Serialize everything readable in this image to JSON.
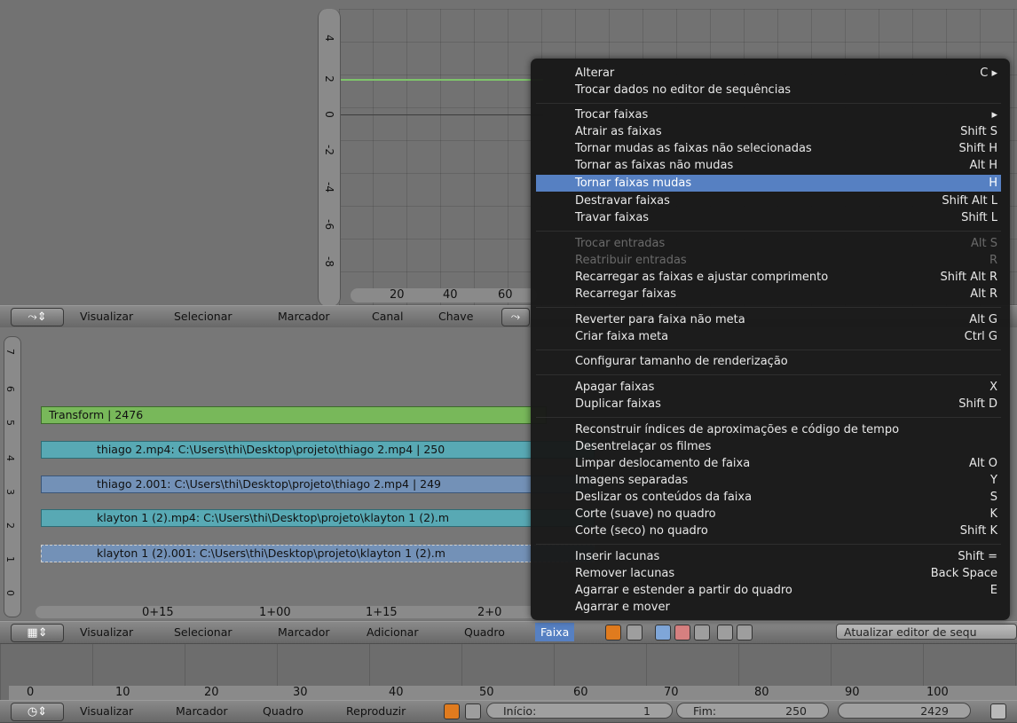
{
  "graph": {
    "vticks": [
      "4",
      "2",
      "0",
      "-2",
      "-4",
      "-6",
      "-8"
    ],
    "hticks": [
      "20",
      "40",
      "60"
    ]
  },
  "graph_header": {
    "items": [
      "Visualizar",
      "Selecionar",
      "Marcador",
      "Canal",
      "Chave"
    ]
  },
  "sequencer": {
    "channels": [
      "7",
      "6",
      "5",
      "4",
      "3",
      "2",
      "1",
      "0"
    ],
    "strips": [
      {
        "label": "Transform | 2476",
        "color": "#78b85a"
      },
      {
        "label": "thiago 2.mp4: C:\\Users\\thi\\Desktop\\projeto\\thiago 2.mp4 | 250",
        "color": "#58a9b4"
      },
      {
        "label": "thiago 2.001: C:\\Users\\thi\\Desktop\\projeto\\thiago 2.mp4 | 249",
        "color": "#7391b7"
      },
      {
        "label": "klayton 1 (2).mp4: C:\\Users\\thi\\Desktop\\projeto\\klayton 1 (2).m",
        "color": "#58a9b4"
      },
      {
        "label": "klayton 1 (2).001: C:\\Users\\thi\\Desktop\\projeto\\klayton 1 (2).m",
        "color": "#7391b7"
      }
    ],
    "timeline_ticks": [
      "0+15",
      "1+00",
      "1+15",
      "2+0"
    ]
  },
  "seq_header": {
    "items": [
      "Visualizar",
      "Selecionar",
      "Marcador",
      "Adicionar",
      "Quadro",
      "Faixa"
    ],
    "refresh_label": "Atualizar editor de sequ"
  },
  "timeline": {
    "ticks": [
      "0",
      "10",
      "20",
      "30",
      "40",
      "50",
      "60",
      "70",
      "80",
      "90",
      "100"
    ]
  },
  "timeline_header": {
    "items": [
      "Visualizar",
      "Marcador",
      "Quadro",
      "Reproduzir"
    ],
    "start_label": "Início:",
    "start_value": "1",
    "end_label": "Fim:",
    "end_value": "250",
    "current_value": "2429"
  },
  "menu": {
    "items": [
      {
        "label": "Alterar",
        "shortcut": "C ▸"
      },
      {
        "label": "Trocar dados no editor de sequências",
        "shortcut": ""
      },
      {
        "label": "Trocar faixas",
        "shortcut": "▸"
      },
      {
        "label": "Atrair as faixas",
        "shortcut": "Shift S"
      },
      {
        "label": "Tornar mudas as faixas não selecionadas",
        "shortcut": "Shift H"
      },
      {
        "label": "Tornar as faixas não mudas",
        "shortcut": "Alt H"
      },
      {
        "label": "Tornar faixas mudas",
        "shortcut": "H"
      },
      {
        "label": "Destravar faixas",
        "shortcut": "Shift Alt L"
      },
      {
        "label": "Travar faixas",
        "shortcut": "Shift L"
      },
      {
        "label": "Trocar entradas",
        "shortcut": "Alt S"
      },
      {
        "label": "Reatribuir entradas",
        "shortcut": "R"
      },
      {
        "label": "Recarregar as faixas e ajustar comprimento",
        "shortcut": "Shift Alt R"
      },
      {
        "label": "Recarregar faixas",
        "shortcut": "Alt R"
      },
      {
        "label": "Reverter para faixa não meta",
        "shortcut": "Alt G"
      },
      {
        "label": "Criar faixa meta",
        "shortcut": "Ctrl G"
      },
      {
        "label": "Configurar tamanho de renderização",
        "shortcut": ""
      },
      {
        "label": "Apagar faixas",
        "shortcut": "X"
      },
      {
        "label": "Duplicar faixas",
        "shortcut": "Shift D"
      },
      {
        "label": "Reconstruir índices de aproximações e código de tempo",
        "shortcut": ""
      },
      {
        "label": "Desentrelaçar os filmes",
        "shortcut": ""
      },
      {
        "label": "Limpar deslocamento de faixa",
        "shortcut": "Alt O"
      },
      {
        "label": "Imagens separadas",
        "shortcut": "Y"
      },
      {
        "label": "Deslizar os conteúdos da faixa",
        "shortcut": "S"
      },
      {
        "label": "Corte (suave) no quadro",
        "shortcut": "K"
      },
      {
        "label": "Corte (seco) no quadro",
        "shortcut": "Shift K"
      },
      {
        "label": "Inserir lacunas",
        "shortcut": "Shift ="
      },
      {
        "label": "Remover lacunas",
        "shortcut": "Back Space"
      },
      {
        "label": "Agarrar e estender a partir do quadro",
        "shortcut": "E"
      },
      {
        "label": "Agarrar e mover",
        "shortcut": ""
      }
    ]
  }
}
